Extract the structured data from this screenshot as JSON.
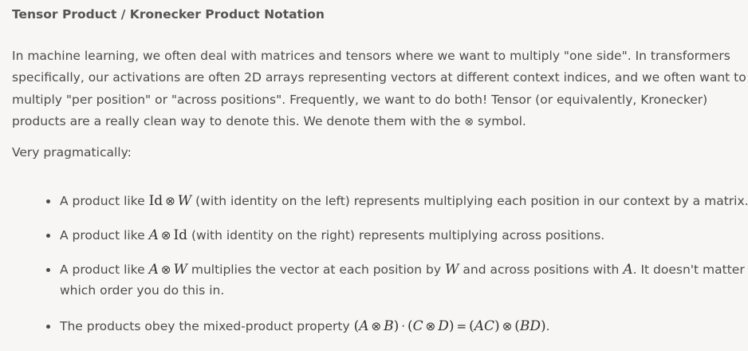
{
  "heading": "Tensor Product / Kronecker Product Notation",
  "intro": {
    "line1": "In machine learning, we often deal with matrices and tensors where we want to multiply \"one side\". In transformers",
    "line2": "specifically, our activations are often 2D arrays representing vectors at different context indices, and we often want to",
    "line3": "multiply \"per position\" or \"across positions\". Frequently, we want to do both! Tensor (or equivalently, Kronecker)",
    "line4_before": "products are a really clean way to denote this. We denote them with the ",
    "line4_symbol": "⊗",
    "line4_after": " symbol."
  },
  "lead": "Very pragmatically:",
  "bullets": [
    {
      "pre": "A product like ",
      "math": [
        "Id",
        "⊗",
        "W"
      ],
      "post": " (with identity on the left) represents multiplying each position in our context by a matrix."
    },
    {
      "pre": "A product like ",
      "math": [
        "A",
        "⊗",
        "Id"
      ],
      "post": " (with identity on the right) represents multiplying across positions."
    },
    {
      "pre": "A product like ",
      "math": [
        "A",
        "⊗",
        "W"
      ],
      "mid": " multiplies the vector at each position by ",
      "math2": "W",
      "mid2": " and across positions with ",
      "math3": "A",
      "post": ". It doesn't matter",
      "line2": "which order you do this in."
    },
    {
      "pre": "The products obey the mixed-product property ",
      "formula": {
        "p1": "(",
        "a": "A",
        "x1": "⊗",
        "b": "B",
        "p2": ")",
        "dot": "·",
        "p3": "(",
        "c": "C",
        "x2": "⊗",
        "d": "D",
        "p4": ")",
        "eq": "=",
        "p5": "(",
        "ac": "AC",
        "p6": ")",
        "x3": "⊗",
        "p7": "(",
        "bd": "BD",
        "p8": ")"
      },
      "post": "."
    }
  ]
}
